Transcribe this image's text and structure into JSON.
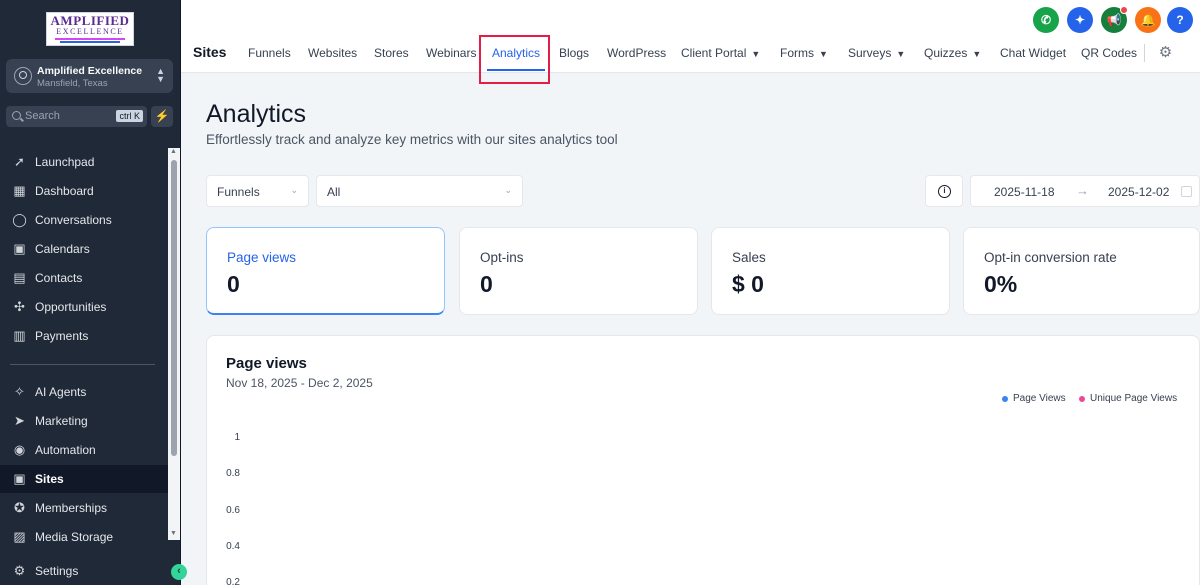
{
  "sidebar": {
    "logo": {
      "line1": "AMPLIFIED",
      "line2": "EXCELLENCE"
    },
    "account": {
      "name": "Amplified Excellence",
      "location": "Mansfield, Texas"
    },
    "search": {
      "placeholder": "Search",
      "shortcut": "ctrl K"
    },
    "items": [
      {
        "label": "Launchpad",
        "icon": "rocket-icon"
      },
      {
        "label": "Dashboard",
        "icon": "grid-icon"
      },
      {
        "label": "Conversations",
        "icon": "chat-icon"
      },
      {
        "label": "Calendars",
        "icon": "calendar-icon"
      },
      {
        "label": "Contacts",
        "icon": "contacts-icon"
      },
      {
        "label": "Opportunities",
        "icon": "opportunities-icon"
      },
      {
        "label": "Payments",
        "icon": "payments-icon"
      },
      {
        "label": "AI Agents",
        "icon": "sparkle-icon"
      },
      {
        "label": "Marketing",
        "icon": "send-icon"
      },
      {
        "label": "Automation",
        "icon": "automation-icon"
      },
      {
        "label": "Sites",
        "icon": "sites-icon"
      },
      {
        "label": "Memberships",
        "icon": "badge-icon"
      },
      {
        "label": "Media Storage",
        "icon": "media-icon"
      },
      {
        "label": "Settings",
        "icon": "gear-icon"
      }
    ]
  },
  "topnav": {
    "section_title": "Sites",
    "tabs": [
      {
        "label": "Funnels"
      },
      {
        "label": "Websites"
      },
      {
        "label": "Stores"
      },
      {
        "label": "Webinars"
      },
      {
        "label": "Analytics",
        "active": true
      },
      {
        "label": "Blogs"
      },
      {
        "label": "WordPress"
      },
      {
        "label": "Client Portal",
        "dropdown": true
      },
      {
        "label": "Forms",
        "dropdown": true
      },
      {
        "label": "Surveys",
        "dropdown": true
      },
      {
        "label": "Quizzes",
        "dropdown": true
      },
      {
        "label": "Chat Widget"
      },
      {
        "label": "QR Codes"
      }
    ],
    "actions": [
      {
        "icon": "phone-icon",
        "color": "#16a34a"
      },
      {
        "icon": "magic-wand-icon",
        "color": "#2563eb"
      },
      {
        "icon": "megaphone-icon",
        "color": "#15803d"
      },
      {
        "icon": "bell-icon",
        "color": "#f97316"
      },
      {
        "icon": "help-icon",
        "color": "#2563eb",
        "glyph": "?"
      }
    ]
  },
  "page": {
    "title": "Analytics",
    "subtitle": "Effortlessly track and analyze key metrics with our sites analytics tool"
  },
  "filters": {
    "type": "Funnels",
    "item": "All",
    "date_start": "2025-11-18",
    "date_end": "2025-12-02"
  },
  "metrics": [
    {
      "label": "Page views",
      "value": "0"
    },
    {
      "label": "Opt-ins",
      "value": "0"
    },
    {
      "label": "Sales",
      "value": "$ 0"
    },
    {
      "label": "Opt-in conversion rate",
      "value": "0%"
    }
  ],
  "chart": {
    "title": "Page views",
    "date_range": "Nov 18, 2025 - Dec 2, 2025",
    "legend": [
      {
        "name": "Page Views",
        "color": "#3b82f6"
      },
      {
        "name": "Unique Page Views",
        "color": "#ec4899"
      }
    ],
    "y_ticks": [
      "1",
      "0.8",
      "0.6",
      "0.4",
      "0.2"
    ]
  },
  "chart_data": {
    "type": "line",
    "title": "Page views",
    "xlabel": "",
    "ylabel": "",
    "ylim": [
      0,
      1
    ],
    "yticks": [
      1,
      0.8,
      0.6,
      0.4,
      0.2
    ],
    "series": [
      {
        "name": "Page Views",
        "values": []
      },
      {
        "name": "Unique Page Views",
        "values": []
      }
    ]
  },
  "colors": {
    "sidebar_bg": "#1f2937",
    "accent": "#2563eb",
    "highlight": "#e11d48"
  }
}
